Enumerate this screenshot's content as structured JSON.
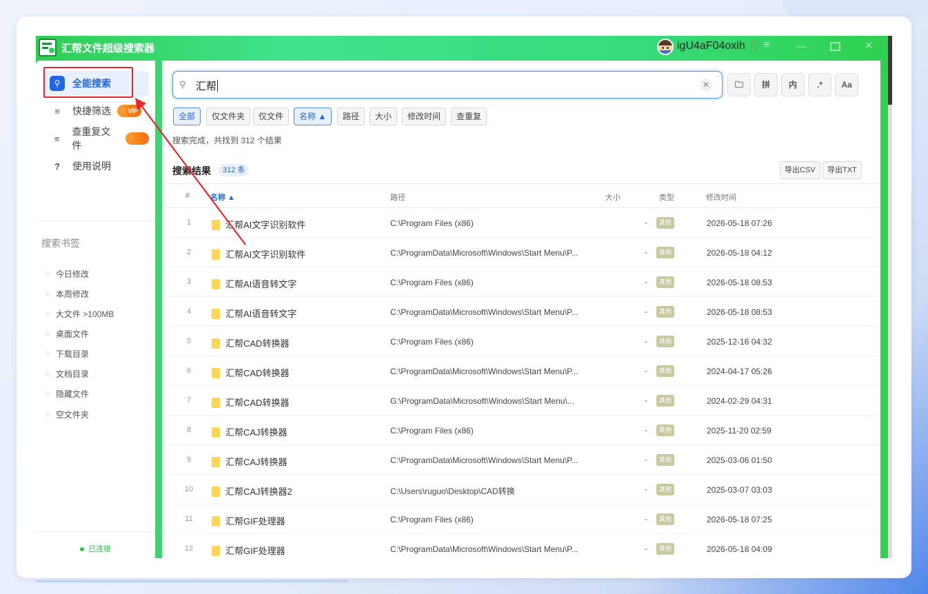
{
  "app": {
    "title": "汇帮文件超级搜索器",
    "username": "igU4aF04oxih",
    "window_controls": [
      "minimize-icon",
      "maximize-icon",
      "close-icon"
    ]
  },
  "sidebar": {
    "items": [
      {
        "icon": "search-icon",
        "label": "全能搜索",
        "active": true
      },
      {
        "icon": "list-icon",
        "label": "快捷筛选",
        "vip": "VIP"
      },
      {
        "icon": "list-icon",
        "label": "查重复文件",
        "vip": "VIP"
      },
      {
        "icon": "help-icon",
        "label": "使用说明"
      }
    ],
    "bookmarks_title": "搜索书签",
    "bookmarks": [
      "今日修改",
      "本周修改",
      "大文件 >100MB",
      "桌面文件",
      "下载目录",
      "文档目录",
      "隐藏文件",
      "空文件夹"
    ],
    "status": "已连接"
  },
  "search": {
    "query": "汇帮",
    "tools": [
      "folder-icon",
      "拼",
      "内",
      ".*",
      "Aa"
    ]
  },
  "filters": [
    {
      "label": "全部",
      "on": true
    },
    {
      "label": "仅文件夹",
      "on": false
    },
    {
      "label": "仅文件",
      "on": false
    },
    {
      "label": "名称 ▲",
      "on": true
    },
    {
      "label": "路径",
      "on": false
    },
    {
      "label": "大小",
      "on": false
    },
    {
      "label": "修改时间",
      "on": false
    },
    {
      "label": "查重复",
      "on": false
    }
  ],
  "summary": "搜索完成，共找到 312 个结果",
  "results": {
    "title": "搜索结果",
    "count_badge": "312 条",
    "export_csv": "导出CSV",
    "export_txt": "导出TXT",
    "columns": [
      "#",
      "名称 ▲",
      "路径",
      "大小",
      "类型",
      "修改时间"
    ],
    "rows": [
      {
        "idx": "1",
        "name": "汇帮AI文字识别软件",
        "path": "C:\\Program Files (x86)",
        "size": "-",
        "type": "其他",
        "time": "2026-05-18 07:26"
      },
      {
        "idx": "2",
        "name": "汇帮AI文字识别软件",
        "path": "C:\\ProgramData\\Microsoft\\Windows\\Start Menu\\P...",
        "size": "-",
        "type": "其他",
        "time": "2026-05-18 04:12"
      },
      {
        "idx": "3",
        "name": "汇帮AI语音转文字",
        "path": "C:\\Program Files (x86)",
        "size": "-",
        "type": "其他",
        "time": "2026-05-18 08:53"
      },
      {
        "idx": "4",
        "name": "汇帮AI语音转文字",
        "path": "C:\\ProgramData\\Microsoft\\Windows\\Start Menu\\P...",
        "size": "-",
        "type": "其他",
        "time": "2026-05-18 08:53"
      },
      {
        "idx": "5",
        "name": "汇帮CAD转换器",
        "path": "C:\\Program Files (x86)",
        "size": "-",
        "type": "其他",
        "time": "2025-12-16 04:32"
      },
      {
        "idx": "6",
        "name": "汇帮CAD转换器",
        "path": "C:\\ProgramData\\Microsoft\\Windows\\Start Menu\\P...",
        "size": "-",
        "type": "其他",
        "time": "2024-04-17 05:26"
      },
      {
        "idx": "7",
        "name": "汇帮CAD转换器",
        "path": "G:\\ProgramData\\Microsoft\\Windows\\Start Menu\\...",
        "size": "-",
        "type": "其他",
        "time": "2024-02-29 04:31"
      },
      {
        "idx": "8",
        "name": "汇帮CAJ转换器",
        "path": "C:\\Program Files (x86)",
        "size": "-",
        "type": "其他",
        "time": "2025-11-20 02:59"
      },
      {
        "idx": "9",
        "name": "汇帮CAJ转换器",
        "path": "C:\\ProgramData\\Microsoft\\Windows\\Start Menu\\P...",
        "size": "-",
        "type": "其他",
        "time": "2025-03-06 01:50"
      },
      {
        "idx": "10",
        "name": "汇帮CAJ转换器2",
        "path": "C:\\Users\\ruguo\\Desktop\\CAD转换",
        "size": "-",
        "type": "其他",
        "time": "2025-03-07 03:03"
      },
      {
        "idx": "11",
        "name": "汇帮GIF处理器",
        "path": "C:\\Program Files (x86)",
        "size": "-",
        "type": "其他",
        "time": "2026-05-18 07:25"
      },
      {
        "idx": "12",
        "name": "汇帮GIF处理器",
        "path": "C:\\ProgramData\\Microsoft\\Windows\\Start Menu\\P...",
        "size": "-",
        "type": "其他",
        "time": "2026-05-18 04:09"
      }
    ]
  },
  "colors": {
    "accent": "#1f65e6",
    "titlebar_green": "#36dc7a",
    "annotation_red": "#e8262a",
    "vip_orange": "#f36d12"
  }
}
